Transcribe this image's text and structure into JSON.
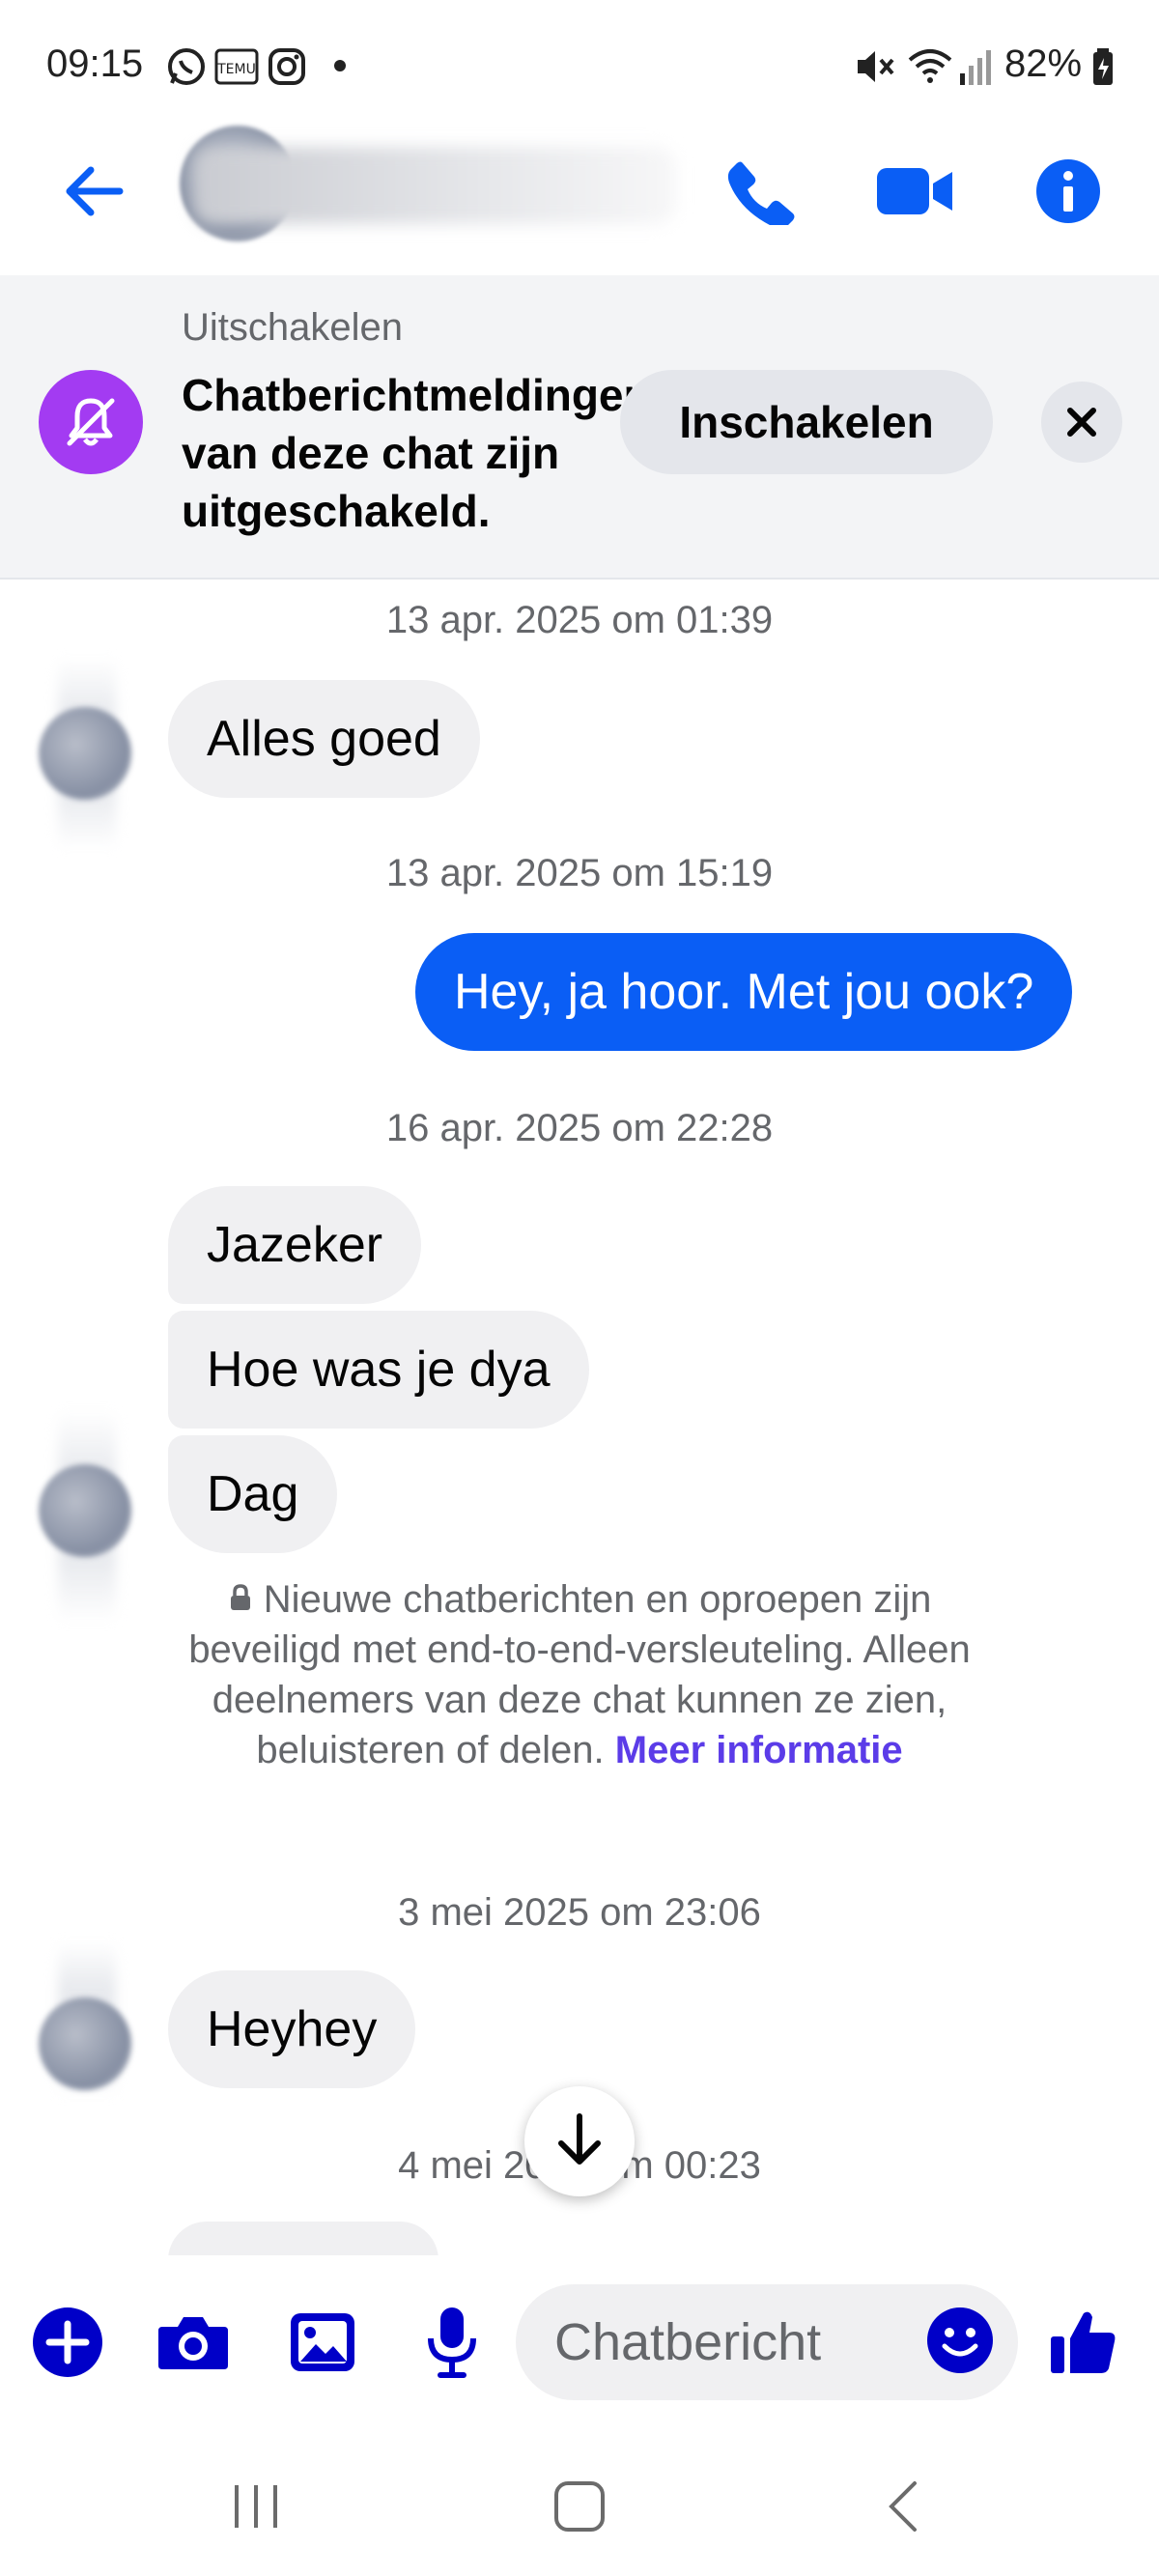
{
  "status_bar": {
    "time": "09:15",
    "dot": "•",
    "battery": "82%",
    "icons": [
      "whatsapp-icon",
      "temu-icon",
      "instagram-icon",
      "mute-icon",
      "wifi-icon",
      "signal-icon",
      "battery-icon"
    ]
  },
  "header": {
    "contact_name": "",
    "icons": [
      "back-arrow-icon",
      "phone-icon",
      "video-icon",
      "info-icon"
    ],
    "accent_color": "#0a5ef5"
  },
  "banner": {
    "kicker": "Uitschakelen",
    "message": "Chatberichtmeldingen van deze chat zijn uitgeschakeld.",
    "enable_label": "Inschakelen",
    "icon": "bell-off-icon",
    "icon_color": "#a33bf2"
  },
  "chat": {
    "timestamps": [
      "13 apr. 2025 om 01:39",
      "13 apr. 2025 om 15:19",
      "16 apr. 2025 om 22:28",
      "3 mei 2025 om 23:06",
      "4 mei 2025 om 00:23"
    ],
    "messages": [
      {
        "text": "Alles goed",
        "direction": "incoming"
      },
      {
        "text": "Hey, ja hoor. Met jou ook?",
        "direction": "outgoing"
      },
      {
        "text": "Jazeker",
        "direction": "incoming"
      },
      {
        "text": "Hoe was je dya",
        "direction": "incoming"
      },
      {
        "text": "Dag",
        "direction": "incoming"
      },
      {
        "text": "Heyhey",
        "direction": "incoming"
      }
    ],
    "e2e_notice": "Nieuwe chatberichten en oproepen zijn beveiligd met end-to-end-versleuteling. Alleen deelnemers van deze chat kunnen ze zien, beluisteren of delen.",
    "e2e_link": "Meer informatie",
    "outgoing_color": "#0a5ef5",
    "incoming_color": "#f0f0f2"
  },
  "composer": {
    "placeholder": "Chatbericht",
    "icons": [
      "plus-icon",
      "camera-icon",
      "gallery-icon",
      "mic-icon",
      "emoji-icon",
      "thumbs-up-icon"
    ],
    "icon_color": "#0000c8"
  },
  "nav_bar": {
    "icons": [
      "recents-icon",
      "home-icon",
      "back-icon"
    ]
  }
}
